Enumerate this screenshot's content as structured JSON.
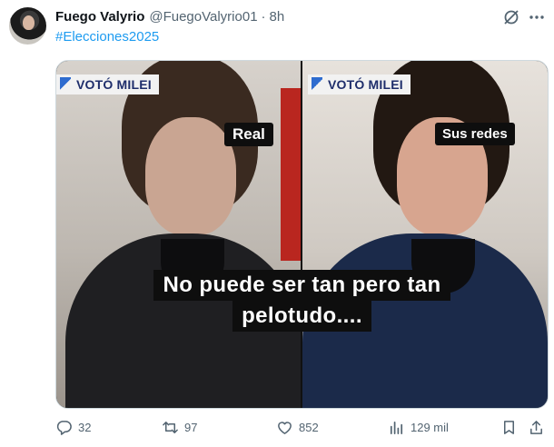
{
  "tweet": {
    "author_name": "Fuego Valyrio",
    "handle": "@FuegoValyrio01",
    "separator": "·",
    "time": "8h",
    "hashtag": "#Elecciones2025"
  },
  "media": {
    "left_chyron": "VOTÓ MILEI",
    "right_chyron": "VOTÓ MILEI",
    "left_label": "Real",
    "right_label": "Sus redes",
    "caption_line1": "No puede ser tan pero tan",
    "caption_line2": "pelotudo...."
  },
  "actions": {
    "replies": "32",
    "reposts": "97",
    "likes": "852",
    "views": "129 mil"
  },
  "icons": {
    "reply": "reply-icon",
    "repost": "repost-icon",
    "like": "heart-icon",
    "views": "views-icon",
    "bookmark": "bookmark-icon",
    "share": "share-icon",
    "grok": "grok-icon",
    "more": "more-icon"
  },
  "colors": {
    "hashtag": "#1d9bf0",
    "muted": "#536471"
  }
}
